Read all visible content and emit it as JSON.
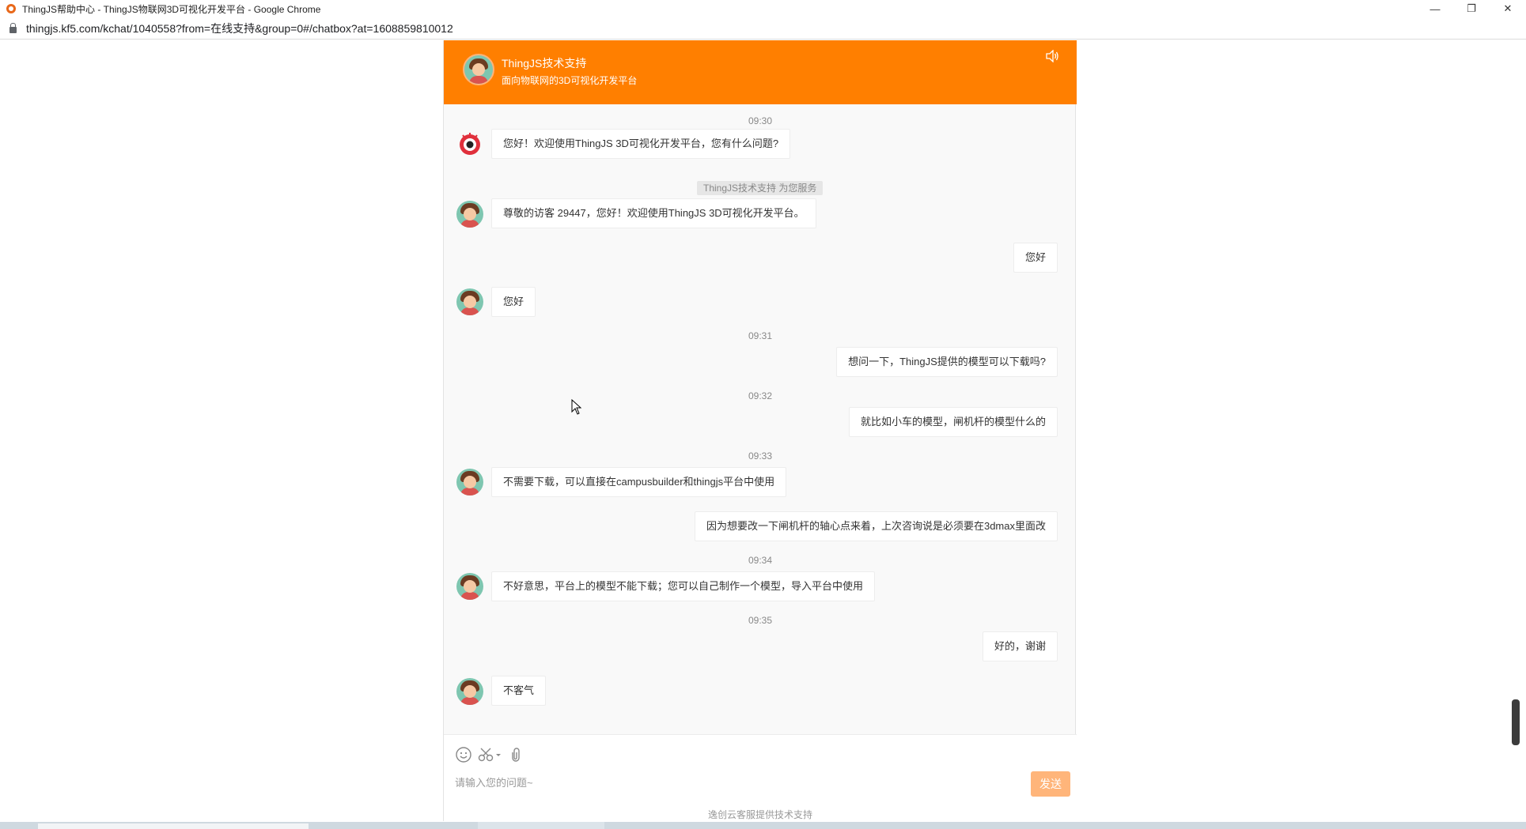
{
  "window": {
    "title": "ThingJS帮助中心 - ThingJS物联网3D可视化开发平台 - Google Chrome",
    "url": "thingjs.kf5.com/kchat/1040558?from=在线支持&group=0#/chatbox?at=1608859810012"
  },
  "header": {
    "name": "ThingJS技术支持",
    "subtitle": "面向物联网的3D可视化开发平台"
  },
  "messages": {
    "t1": "09:30",
    "m1": "您好！欢迎使用ThingJS 3D可视化开发平台，您有什么问题?",
    "sys": "ThingJS技术支持 为您服务",
    "m2": "尊敬的访客 29447，您好！欢迎使用ThingJS 3D可视化开发平台。",
    "m3": "您好",
    "m4": "您好",
    "t2": "09:31",
    "m5": "想问一下，ThingJS提供的模型可以下载吗?",
    "t3": "09:32",
    "m6": "就比如小车的模型，闸机杆的模型什么的",
    "t4": "09:33",
    "m7": "不需要下载，可以直接在campusbuilder和thingjs平台中使用",
    "m8": "因为想要改一下闸机杆的轴心点来着，上次咨询说是必须要在3dmax里面改",
    "t5": "09:34",
    "m9": "不好意思，平台上的模型不能下载；您可以自己制作一个模型，导入平台中使用",
    "t6": "09:35",
    "m10": "好的，谢谢",
    "m11": "不客气"
  },
  "composer": {
    "placeholder": "请输入您的问题~",
    "send_label": "发送"
  },
  "footer": {
    "text": "逸创云客服提供技术支持"
  },
  "colors": {
    "header_bg": "#ff7f00",
    "send_bg": "#ffb57a"
  },
  "icons": [
    "speaker-icon",
    "emoji-icon",
    "scissors-icon",
    "attachment-icon",
    "lock-icon"
  ]
}
